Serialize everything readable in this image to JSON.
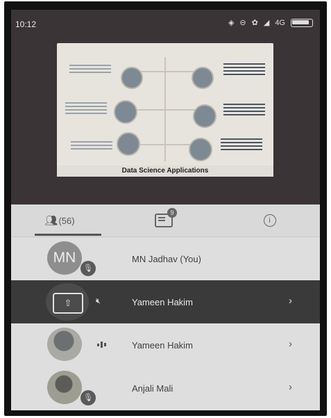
{
  "status_bar": {
    "time": "10:12",
    "network_label": "4G"
  },
  "slide": {
    "title": "Data Science Applications"
  },
  "tabs": {
    "people_count": "(56)",
    "chat_badge": "9"
  },
  "participants": [
    {
      "initials": "MN",
      "name": "MN Jadhav (You)",
      "muted": true
    },
    {
      "name": "Yameen Hakim",
      "presenting": true
    },
    {
      "name": "Yameen Hakim",
      "speaking": true
    },
    {
      "name": "Anjali Mali",
      "muted": true
    }
  ],
  "icons": {
    "chevron": "›"
  },
  "colors": {
    "video_background": "#3a3436",
    "list_background": "#dedede",
    "presenting_row": "#3a3a3a"
  }
}
